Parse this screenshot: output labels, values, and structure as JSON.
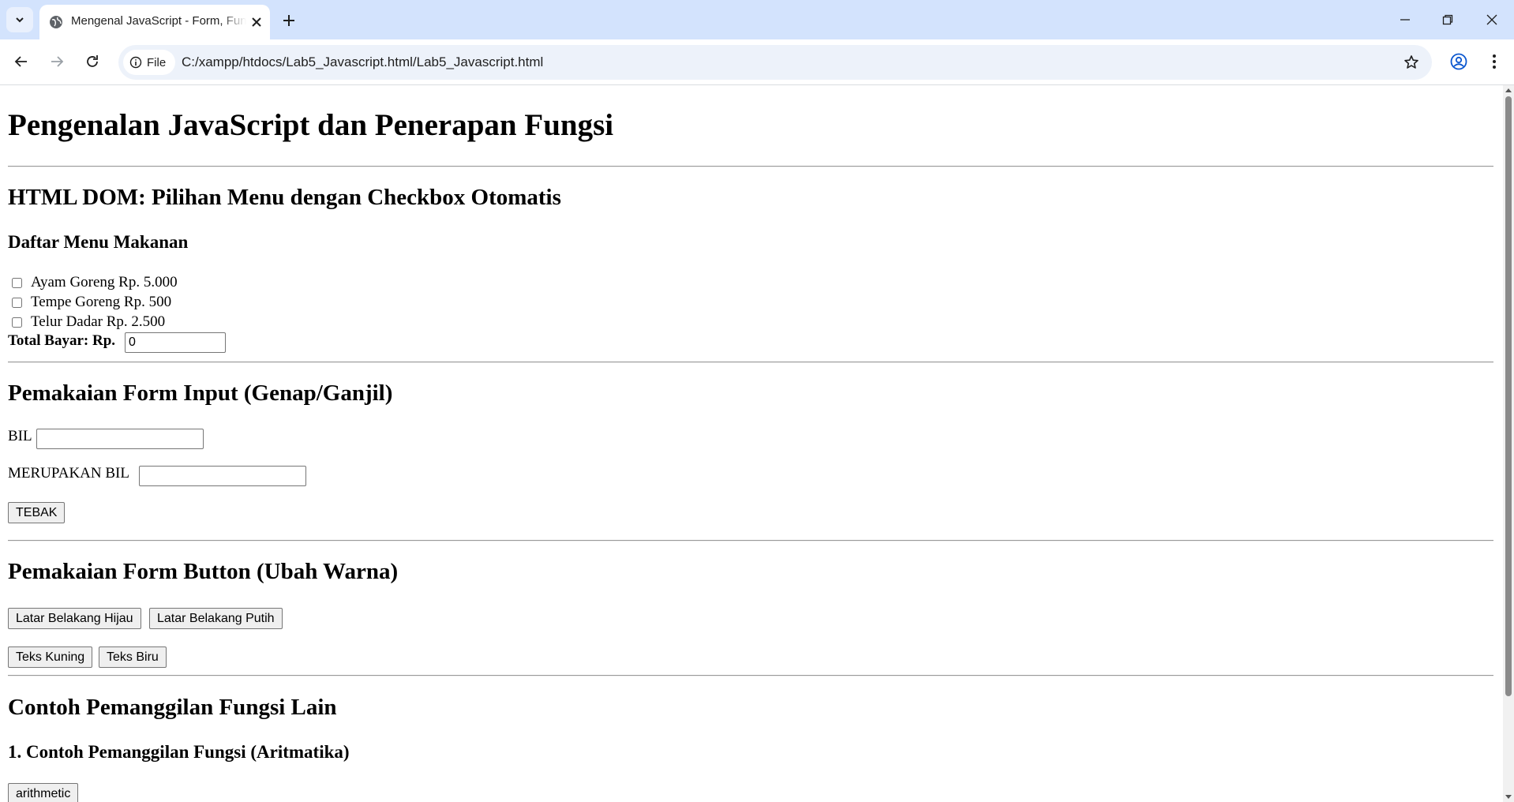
{
  "browser": {
    "tab_title": "Mengenal JavaScript - Form, Fungsi",
    "site_chip_label": "File",
    "url": "C:/xampp/htdocs/Lab5_Javascript.html/Lab5_Javascript.html"
  },
  "page": {
    "title": "Pengenalan JavaScript dan Penerapan Fungsi",
    "section_menu": {
      "heading": "HTML DOM: Pilihan Menu dengan Checkbox Otomatis",
      "subheading": "Daftar Menu Makanan",
      "items": [
        {
          "label": "Ayam Goreng Rp. 5.000",
          "checked": false
        },
        {
          "label": "Tempe Goreng Rp. 500",
          "checked": false
        },
        {
          "label": "Telur Dadar Rp. 2.500",
          "checked": false
        }
      ],
      "total_label": "Total Bayar: Rp.",
      "total_value": "0"
    },
    "section_genap": {
      "heading": "Pemakaian Form Input (Genap/Ganjil)",
      "bil_label": "BIL",
      "bil_value": "",
      "merupakan_label": "MERUPAKAN BIL",
      "merupakan_value": "",
      "tebak_button": "TEBAK"
    },
    "section_warna": {
      "heading": "Pemakaian Form Button (Ubah Warna)",
      "btn_hijau": "Latar Belakang Hijau",
      "btn_putih": "Latar Belakang Putih",
      "btn_kuning": "Teks Kuning",
      "btn_biru": "Teks Biru"
    },
    "section_fungsi": {
      "heading": "Contoh Pemanggilan Fungsi Lain",
      "subheading": "1. Contoh Pemanggilan Fungsi (Aritmatika)",
      "arithmetic_button": "arithmetic"
    }
  }
}
